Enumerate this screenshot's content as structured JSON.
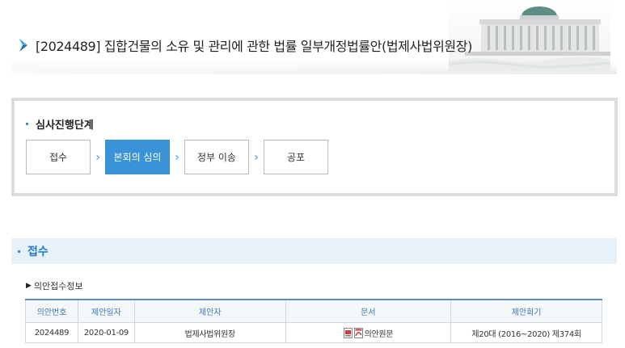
{
  "header": {
    "title": "[2024489] 집합건물의 소유 및 관리에 관한 법률 일부개정법률안(법제사법위원장)"
  },
  "stages": {
    "title": "심사진행단계",
    "steps": [
      {
        "label": "접수",
        "active": false
      },
      {
        "label": "본회의 심의",
        "active": true
      },
      {
        "label": "정부 이송",
        "active": false
      },
      {
        "label": "공포",
        "active": false
      }
    ]
  },
  "section": {
    "title": "접수",
    "subtitle": "의안접수정보"
  },
  "table": {
    "headers": [
      "의안번호",
      "제안일자",
      "제안자",
      "문서",
      "제안회기"
    ],
    "rows": [
      {
        "bill_no": "2024489",
        "date": "2020-01-09",
        "proposer": "법제사법위원장",
        "document": "의안원문",
        "session": "제20대 (2016~2020) 제374회"
      }
    ]
  },
  "icons": [
    "chevron-right-icon",
    "hwp-file-icon",
    "pdf-file-icon",
    "building-image"
  ],
  "colors": {
    "accent": "#3a93d6",
    "section_bg": "#e6f1fa",
    "section_text": "#1f7cc4"
  }
}
